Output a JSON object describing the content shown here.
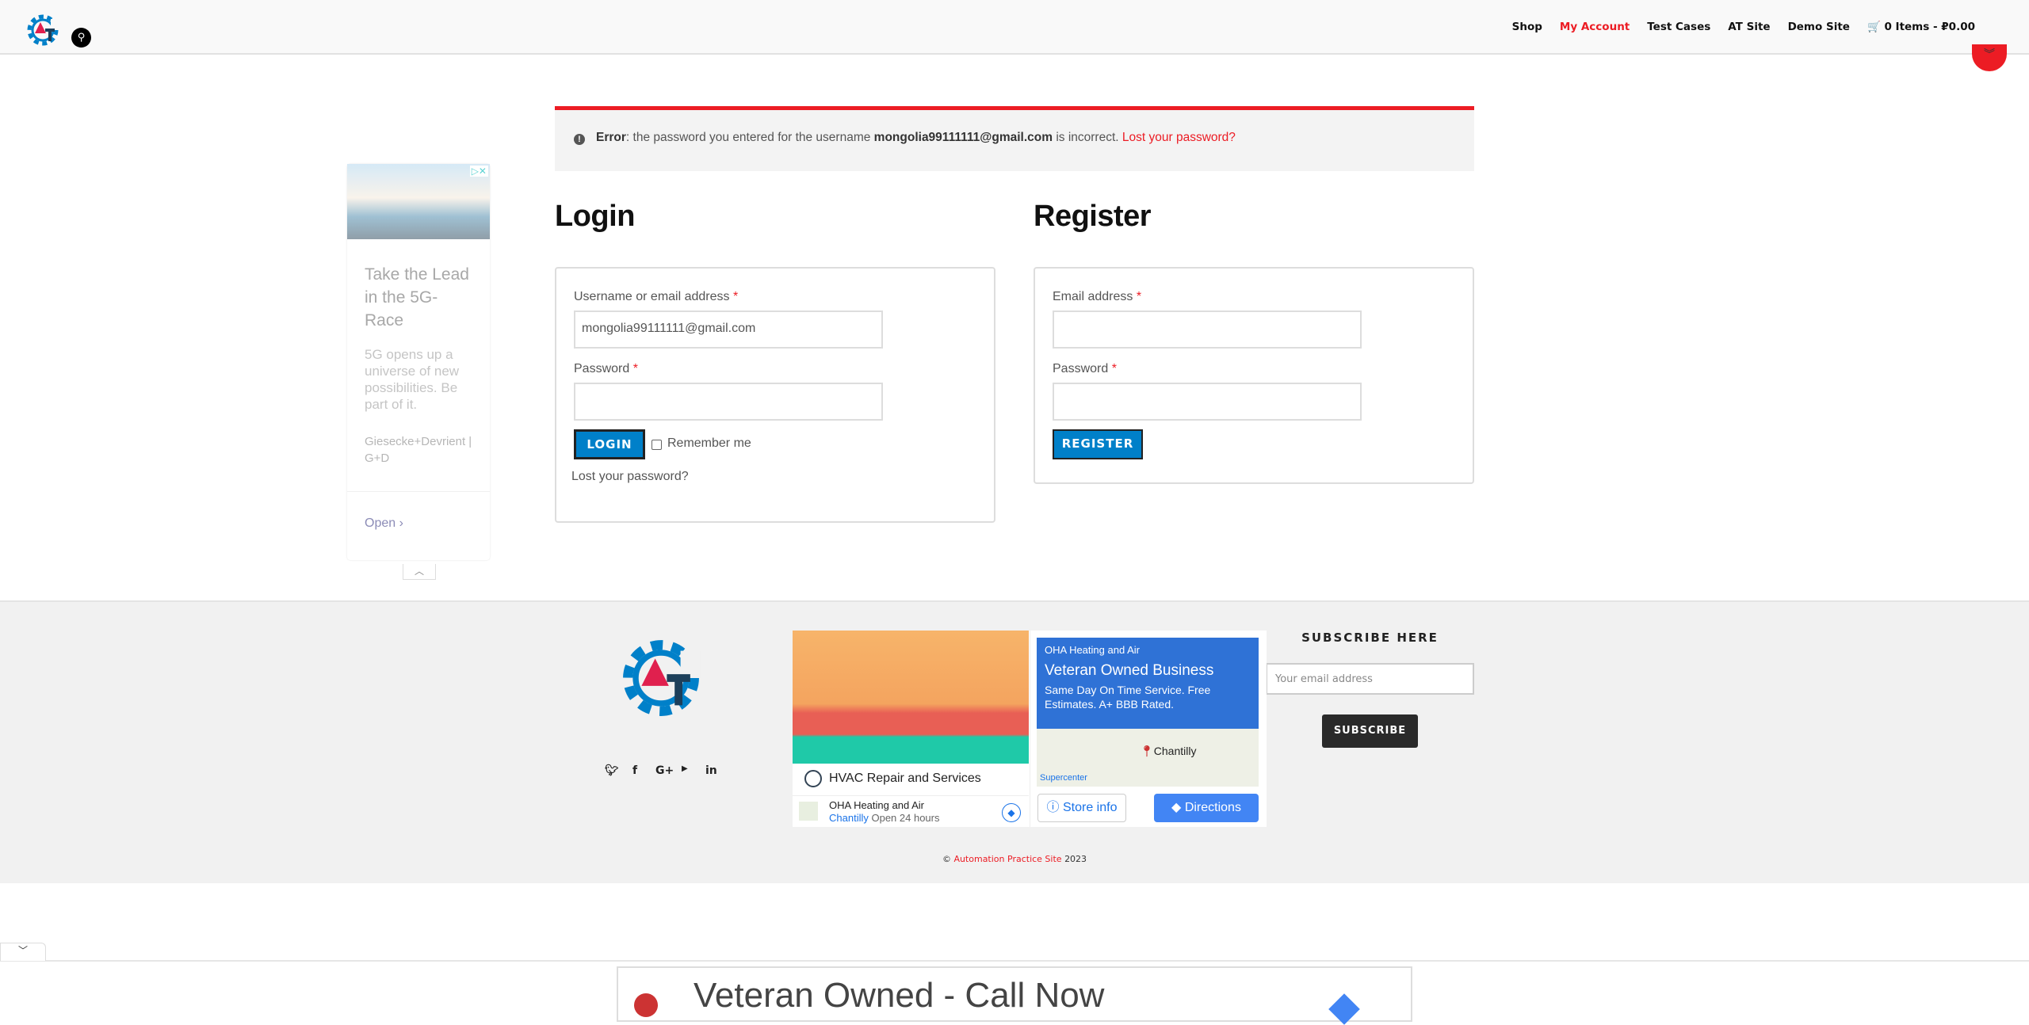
{
  "header": {
    "logo": "AT",
    "nav": [
      "Shop",
      "My Account",
      "Test Cases",
      "AT Site",
      "Demo Site"
    ],
    "active": "My Account",
    "cart": "0 Items - ₽0.00"
  },
  "error": {
    "label": "Error",
    "text1": ": the password you entered for the username ",
    "username": "mongolia99111111@gmail.com",
    "text2": " is incorrect. ",
    "link": "Lost your password?"
  },
  "login": {
    "title": "Login",
    "username_label": "Username or email address",
    "username_value": "mongolia99111111@gmail.com",
    "password_label": "Password",
    "required": "*",
    "button": "LOGIN",
    "remember": "Remember me",
    "lost": "Lost your password?"
  },
  "register": {
    "title": "Register",
    "email_label": "Email address",
    "password_label": "Password",
    "required": "*",
    "button": "REGISTER"
  },
  "ad_left": {
    "title": "Take the Lead in the 5G-Race",
    "body": "5G opens up a universe of new possibilities. Be part of it.",
    "advertiser": "Giesecke+Devrient | G+D",
    "cta": "Open"
  },
  "ad_mid": {
    "headline": "HVAC Repair and Services",
    "business": "OHA Heating and Air",
    "location": "Chantilly",
    "hours": "Open 24 hours",
    "title": "Veteran Owned Business",
    "desc": "Same Day On Time Service. Free Estimates. A+ BBB Rated.",
    "map_label": "Chantilly",
    "map_poi": "Supercenter",
    "store_info": "Store info",
    "directions": "Directions"
  },
  "footer": {
    "subscribe_title": "SUBSCRIBE HERE",
    "email_placeholder": "Your email address",
    "subscribe_button": "SUBSCRIBE",
    "copyright": "©",
    "site": "Automation Practice Site",
    "year": "2023",
    "social": [
      "twitter",
      "facebook",
      "google-plus",
      "youtube",
      "linkedin"
    ]
  },
  "bottom_ad": {
    "title": "Veteran Owned - Call Now"
  }
}
